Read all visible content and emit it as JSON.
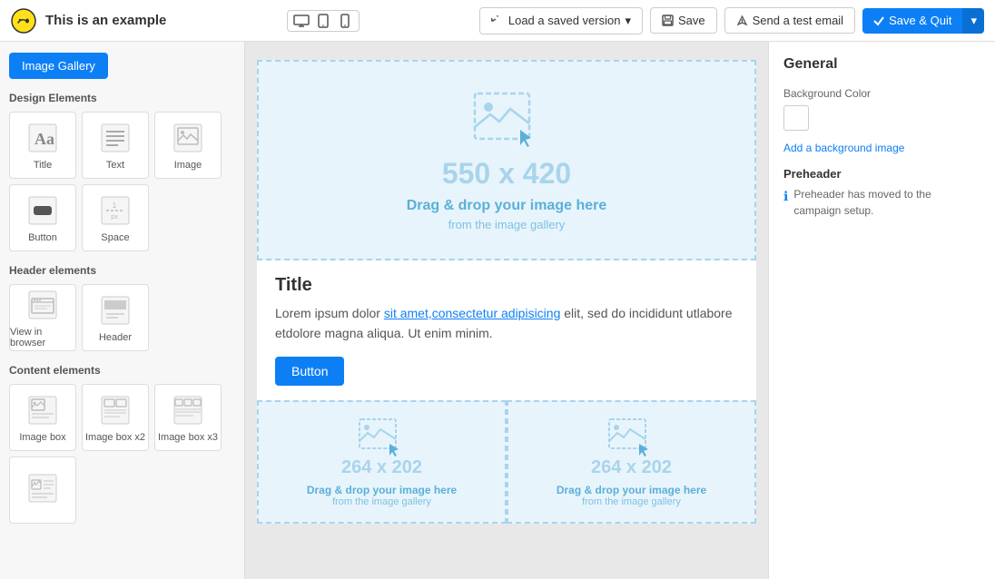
{
  "topbar": {
    "logo_alt": "Mailchimp logo",
    "title": "This is an example",
    "devices": [
      {
        "name": "desktop",
        "label": "Desktop"
      },
      {
        "name": "tablet",
        "label": "Tablet"
      },
      {
        "name": "mobile",
        "label": "Mobile"
      }
    ],
    "load_version_label": "Load a saved version",
    "save_label": "Save",
    "send_test_label": "Send a test email",
    "save_quit_label": "Save & Quit"
  },
  "left_panel": {
    "image_gallery_btn": "Image Gallery",
    "design_elements_title": "Design Elements",
    "design_elements": [
      {
        "name": "title-element",
        "label": "Title",
        "icon": "title"
      },
      {
        "name": "text-element",
        "label": "Text",
        "icon": "text"
      },
      {
        "name": "image-element",
        "label": "Image",
        "icon": "image"
      },
      {
        "name": "button-element",
        "label": "Button",
        "icon": "button"
      },
      {
        "name": "space-element",
        "label": "Space",
        "icon": "space"
      }
    ],
    "header_elements_title": "Header elements",
    "header_elements": [
      {
        "name": "view-in-browser-element",
        "label": "View in browser",
        "icon": "browser"
      },
      {
        "name": "header-element",
        "label": "Header",
        "icon": "header"
      }
    ],
    "content_elements_title": "Content elements",
    "content_elements": [
      {
        "name": "image-box-element",
        "label": "Image box",
        "icon": "imagebox"
      },
      {
        "name": "image-box-x2-element",
        "label": "Image box x2",
        "icon": "imageboxX2"
      },
      {
        "name": "image-box-x3-element",
        "label": "Image box x3",
        "icon": "imageboxX3"
      },
      {
        "name": "image-text-element",
        "label": "",
        "icon": "imagetext"
      }
    ]
  },
  "canvas": {
    "main_drop_zone": {
      "size": "550 x 420",
      "drop_text": "Drag & drop your image here",
      "drop_sub": "from the image gallery"
    },
    "content_block": {
      "heading": "Title",
      "body": "Lorem ipsum dolor ",
      "link_text": "sit amet,consectetur adipisicing",
      "body_after": " elit, sed do incididunt utlabore etdolore magna aliqua. Ut enim minim.",
      "button_label": "Button"
    },
    "left_drop_zone": {
      "size": "264 x 202",
      "drop_text": "Drag & drop your image here",
      "drop_sub": "from the image gallery"
    },
    "right_drop_zone": {
      "size": "264 x 202",
      "drop_text": "Drag & drop your image here",
      "drop_sub": "from the image gallery"
    }
  },
  "right_panel": {
    "title": "General",
    "background_color_label": "Background Color",
    "add_bg_image_link": "Add a background image",
    "preheader_title": "Preheader",
    "preheader_info": "Preheader has moved to the campaign setup."
  }
}
